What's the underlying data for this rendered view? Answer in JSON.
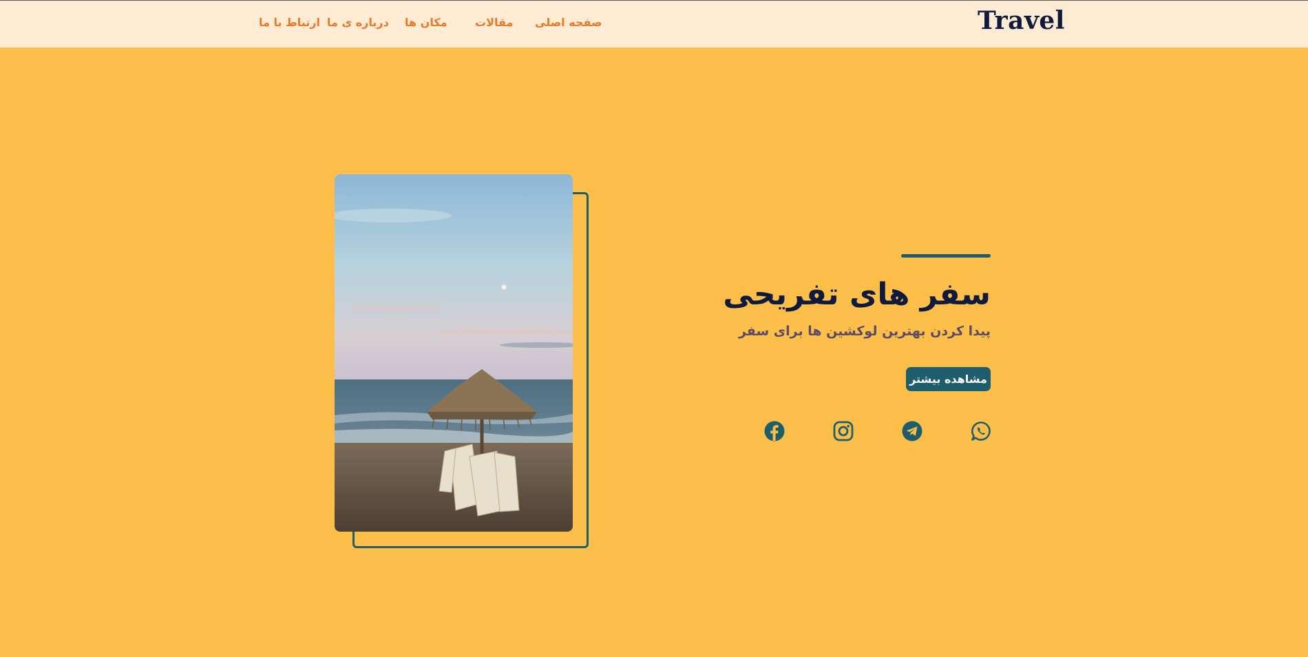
{
  "brand": {
    "logo": "Travel"
  },
  "nav": {
    "home": "صفحه اصلی",
    "articles": "مقالات",
    "places": "مکان ها",
    "about": "درباره ی ما",
    "contact": "ارتباط با ما"
  },
  "hero": {
    "title": "سفر های تفریحی",
    "subtitle": "پیدا کردن بهترین لوکشین ها برای سفر",
    "cta_label": "مشاهده بیشتر",
    "image": "beach-umbrella-photo"
  },
  "social": [
    {
      "name": "whatsapp-icon"
    },
    {
      "name": "telegram-icon"
    },
    {
      "name": "instagram-icon"
    },
    {
      "name": "facebook-icon"
    }
  ],
  "colors": {
    "background": "#fdbf4a",
    "header": "#fdecd3",
    "nav_text": "#e8792a",
    "accent": "#1e5d6b",
    "title": "#0f1a3d"
  }
}
